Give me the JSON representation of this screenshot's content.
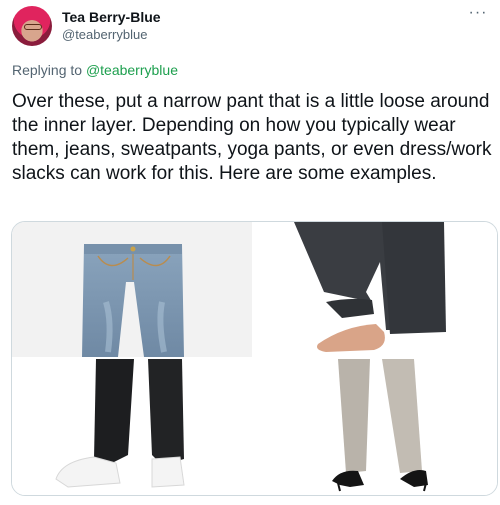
{
  "tweet": {
    "author_name": "Tea Berry-Blue",
    "author_handle": "@teaberryblue",
    "replying_prefix": "Replying to",
    "replying_handle": "@teaberryblue",
    "text": "Over these, put a narrow pant that is a little loose around the inner layer. Depending on how you typically wear them, jeans, sweatpants, yoga pants, or even dress/work slacks can work for this. Here are some examples.",
    "more_icon": "ellipsis-icon"
  },
  "media": {
    "images": [
      {
        "subject": "light-wash slim jeans",
        "icon": "jeans-photo"
      },
      {
        "subject": "dark loose yoga pants with bare foot",
        "icon": "yoga-pants-photo"
      },
      {
        "subject": "black jogger sweatpants with white sneakers",
        "icon": "sweatpants-photo"
      },
      {
        "subject": "grey dress slacks with black heels",
        "icon": "slacks-photo"
      }
    ]
  },
  "colors": {
    "text": "#0f1419",
    "secondary": "#536471",
    "mention": "#1d9f4e",
    "border": "#cfd9de",
    "avatar_hair": "#e0245e"
  }
}
